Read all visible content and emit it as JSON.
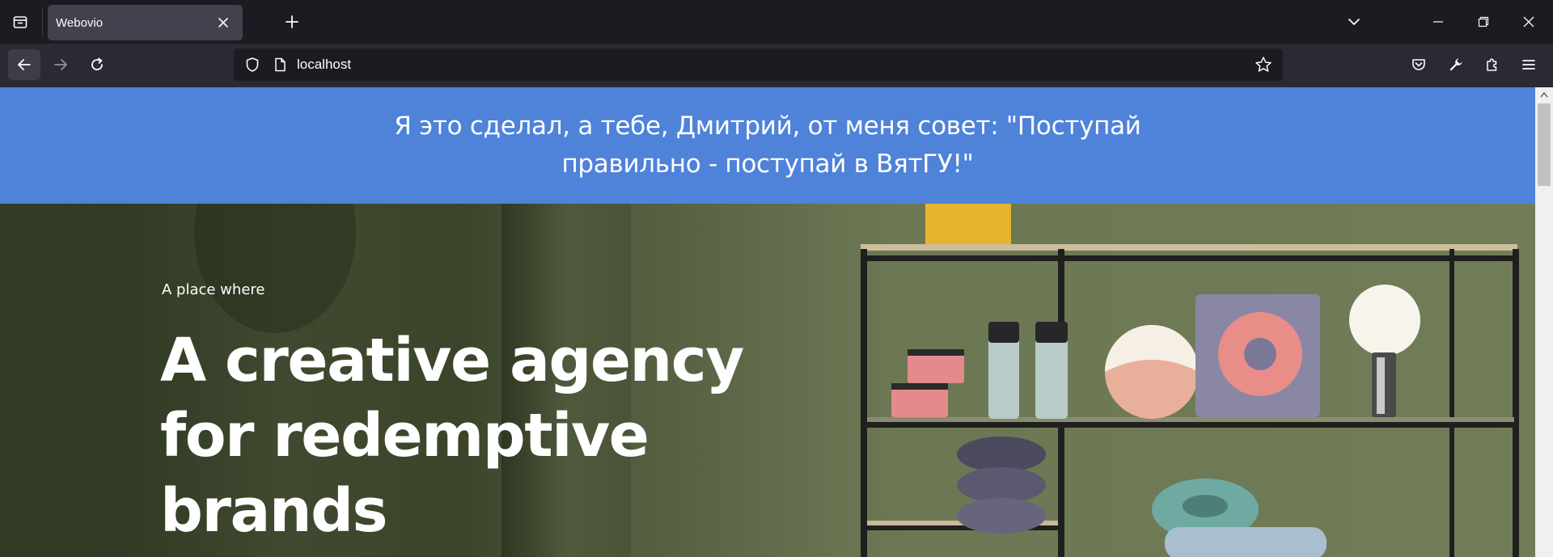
{
  "browser": {
    "tab": {
      "title": "Webovio"
    },
    "url": "localhost"
  },
  "page": {
    "banner_text": "Я это сделал, а тебе, Дмитрий, от меня совет: \"Поступай правильно - поступай в ВятГУ!\"",
    "hero": {
      "kicker": "A place where",
      "title": "A creative agency for redemptive brands"
    }
  },
  "colors": {
    "banner_bg": "#4f82d9",
    "browser_chrome": "#1c1b22",
    "toolbar": "#2b2a33"
  }
}
